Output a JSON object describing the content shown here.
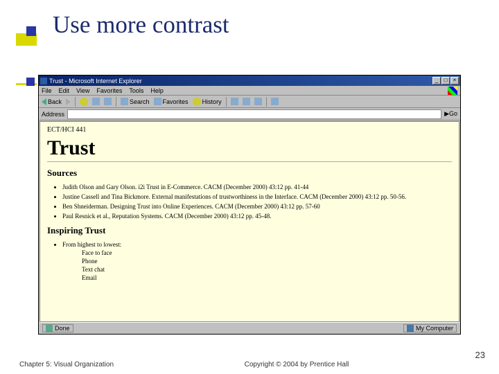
{
  "slide": {
    "title": "Use more contrast",
    "footer_left": "Chapter 5: Visual Organization",
    "footer_center": "Copyright © 2004 by Prentice Hall",
    "page_number": "23"
  },
  "browser": {
    "window_title": "Trust - Microsoft Internet Explorer",
    "win_min": "_",
    "win_max": "□",
    "win_close": "×",
    "menu": {
      "file": "File",
      "edit": "Edit",
      "view": "View",
      "favorites": "Favorites",
      "tools": "Tools",
      "help": "Help"
    },
    "toolbar": {
      "back": "Back",
      "search": "Search",
      "favorites": "Favorites",
      "history": "History"
    },
    "address_label": "Address",
    "go_label": "Go",
    "status_left": "Done",
    "status_right": "My Computer"
  },
  "page": {
    "breadcrumb": "ECT/HCI 441",
    "h1": "Trust",
    "sources_heading": "Sources",
    "sources": [
      "Judith Olson and Gary Olson. i2i Trust in E-Commerce. CACM (December 2000) 43:12 pp. 41-44",
      "Justine Cassell and Tina Bickmore. External manifestations of trustworthiness in the Interface. CACM (December 2000) 43:12 pp. 50-56.",
      "Ben Shneiderman. Designing Trust into Online Experiences. CACM (December 2000) 43:12 pp. 57-60",
      "Paul Resnick et al., Reputation Systems. CACM (December 2000) 43:12 pp. 45-48."
    ],
    "inspire_heading": "Inspiring Trust",
    "inspire_lead": "From highest to lowest:",
    "inspire_items": [
      "Face to face",
      "Phone",
      "Text chat",
      "Email"
    ]
  }
}
